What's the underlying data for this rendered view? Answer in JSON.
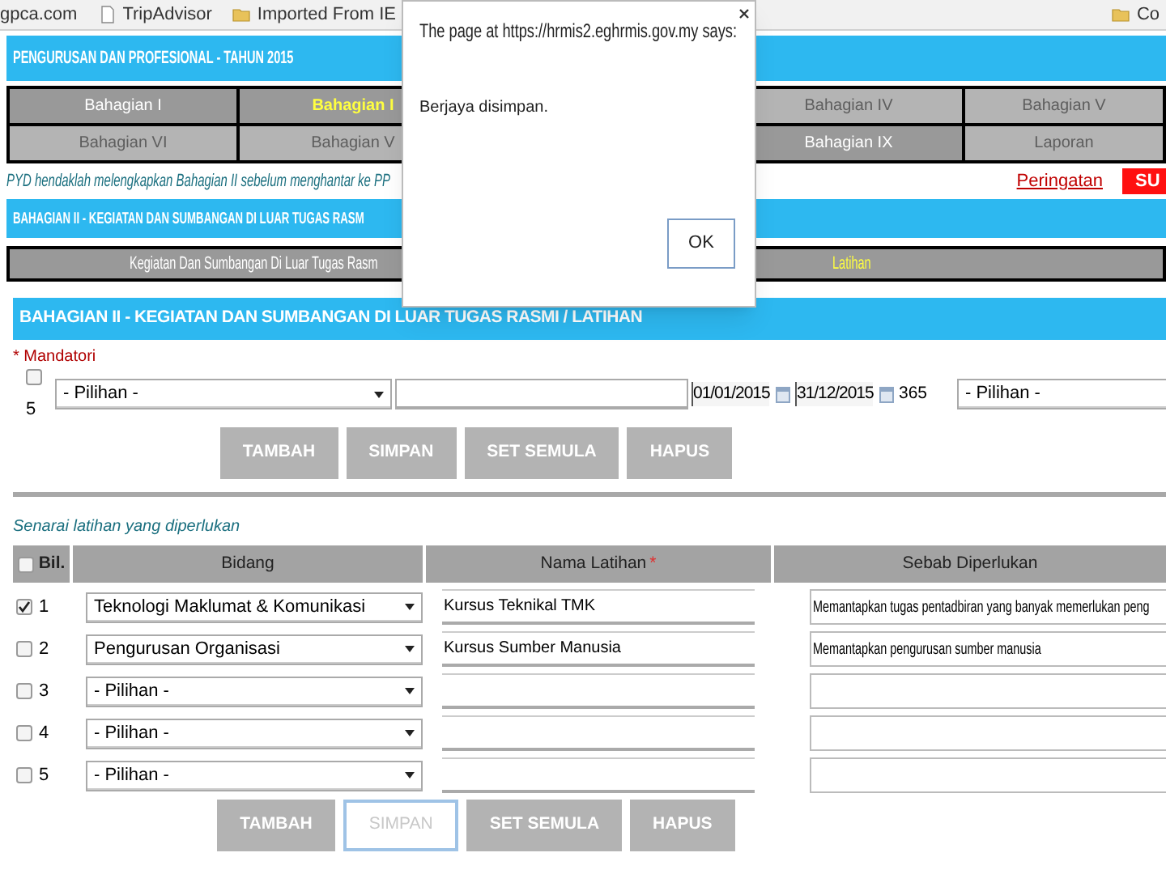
{
  "bookmarks_bar": {
    "items": [
      {
        "label": "gpca.com"
      },
      {
        "label": "TripAdvisor",
        "kind": "page"
      },
      {
        "label": "Imported From IE",
        "kind": "folder"
      },
      {
        "label": "Co",
        "kind": "folder"
      }
    ]
  },
  "page_title": "PENGURUSAN DAN PROFESIONAL - TAHUN 2015",
  "section_tabs": [
    [
      {
        "label": "Bahagian I",
        "selected": false,
        "disabled": false
      },
      {
        "label": "Bahagian I",
        "selected": true,
        "disabled": false
      },
      {
        "label": "Bahagian IV",
        "selected": false,
        "disabled": true
      },
      {
        "label": "Bahagian V",
        "selected": false,
        "disabled": true
      }
    ],
    [
      {
        "label": "Bahagian VI",
        "selected": false,
        "disabled": true
      },
      {
        "label": "Bahagian V",
        "selected": false,
        "disabled": true
      },
      {
        "label": "Bahagian IX",
        "selected": false,
        "disabled": false
      },
      {
        "label": "Laporan",
        "selected": false,
        "disabled": true
      }
    ]
  ],
  "notice": "PYD hendaklah melengkapkan Bahagian II sebelum menghantar ke PP",
  "warning_link": "Peringatan",
  "submit_button": "SU",
  "section_header": "BAHAGIAN II - KEGIATAN DAN SUMBANGAN DI LUAR TUGAS RASM",
  "sub_tabs": [
    {
      "label": "Kegiatan Dan Sumbangan Di Luar Tugas Rasm",
      "selected": false
    },
    {
      "label": "Latihan",
      "selected": true
    }
  ],
  "form_header": "BAHAGIAN II - KEGIATAN DAN SUMBANGAN DI LUAR TUGAS RASMI / LATIHAN",
  "mandatory_note": "* Mandatori",
  "entry_row": {
    "checked": false,
    "number": "5",
    "category": "- Pilihan -",
    "start_date": "01/01/2015",
    "end_date": "31/12/2015",
    "days": "365",
    "type": "- Pilihan -"
  },
  "entry_buttons": [
    {
      "label": "TAMBAH",
      "focused": false
    },
    {
      "label": "SIMPAN",
      "focused": false
    },
    {
      "label": "SET SEMULA",
      "focused": false
    },
    {
      "label": "HAPUS",
      "focused": false
    }
  ],
  "training_list": {
    "title": "Senarai latihan yang diperlukan",
    "columns": [
      {
        "label": "Bil.",
        "kind": "checkbox",
        "checked": false
      },
      {
        "label": "Bidang",
        "kind": "text"
      },
      {
        "label": "Nama Latihan",
        "kind": "text",
        "required_mark": "*"
      },
      {
        "label": "Sebab Diperlukan",
        "kind": "text"
      }
    ],
    "rows": [
      {
        "number": "1",
        "checked": true,
        "field": "Teknologi Maklumat & Komunikasi",
        "training": "Kursus Teknikal TMK",
        "reason": "Memantapkan tugas pentadbiran yang banyak memerlukan peng"
      },
      {
        "number": "2",
        "checked": false,
        "field": "Pengurusan Organisasi",
        "training": "Kursus Sumber Manusia",
        "reason": "Memantapkan pengurusan sumber manusia"
      },
      {
        "number": "3",
        "checked": false,
        "field": "- Pilihan -"
      },
      {
        "number": "4",
        "checked": false,
        "field": "- Pilihan -"
      },
      {
        "number": "5",
        "checked": false,
        "field": "- Pilihan -"
      }
    ]
  },
  "list_buttons": [
    {
      "label": "TAMBAH",
      "focused": false
    },
    {
      "label": "SIMPAN",
      "focused": true
    },
    {
      "label": "SET SEMULA",
      "focused": false
    },
    {
      "label": "HAPUS",
      "focused": false
    }
  ],
  "dialog": {
    "title": "The page at https://hrmis2.eghrmis.gov.my says:",
    "message": "Berjaya disimpan.",
    "button": "OK"
  }
}
